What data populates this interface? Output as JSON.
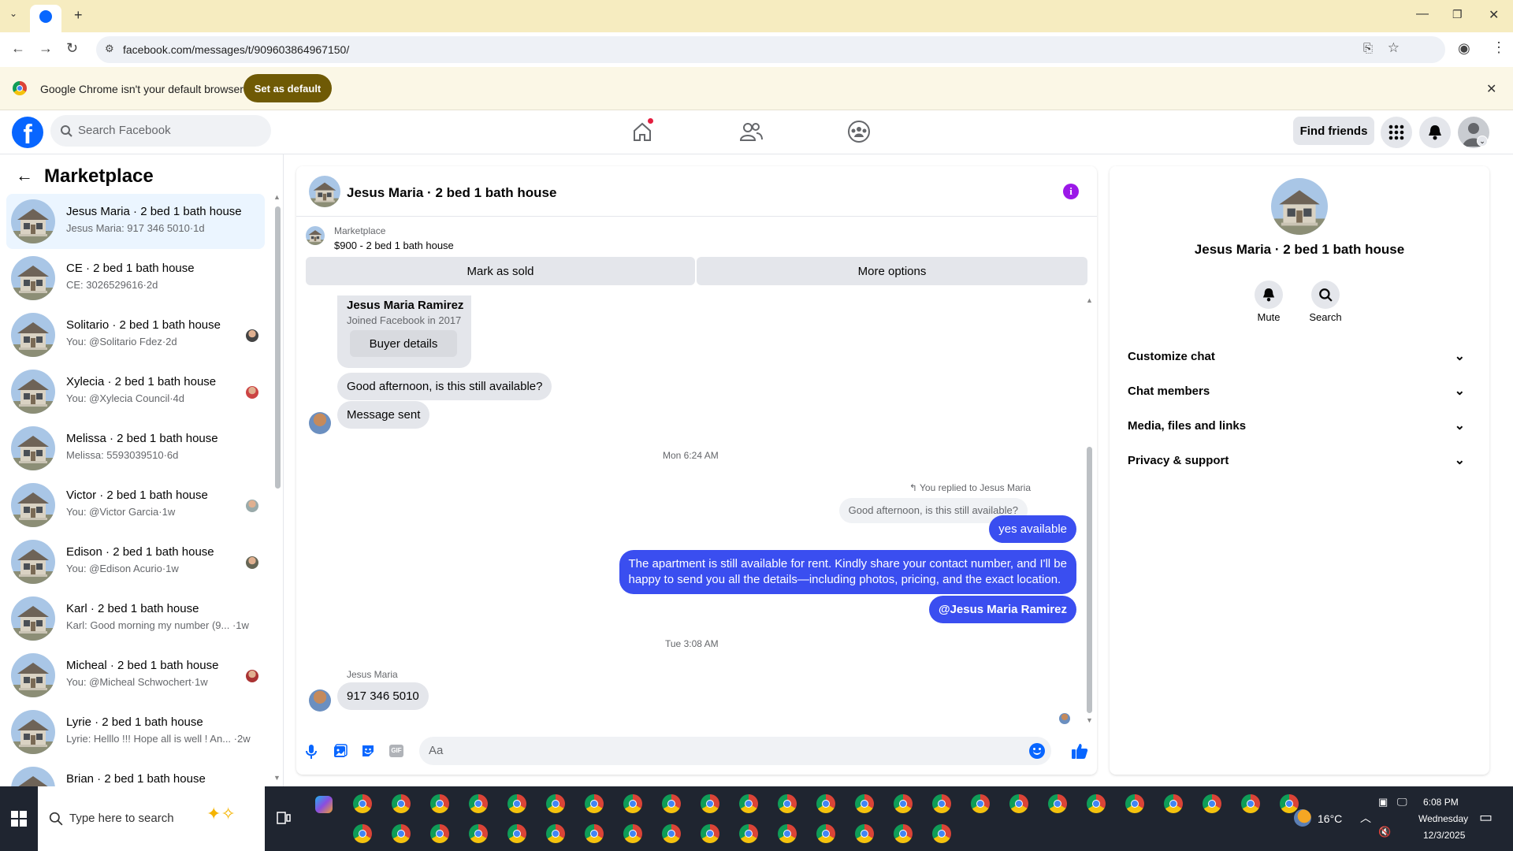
{
  "browser": {
    "url": "facebook.com/messages/t/909603864967150/",
    "infobar_text": "Google Chrome isn't your default browser",
    "set_default_label": "Set as default"
  },
  "fb": {
    "search_placeholder": "Search Facebook",
    "find_friends": "Find friends"
  },
  "left": {
    "title": "Marketplace",
    "conversations": [
      {
        "title": "Jesus Maria · 2 bed 1 bath house",
        "sub": "Jesus Maria: 917 346 5010·1d"
      },
      {
        "title": "CE · 2 bed 1 bath house",
        "sub": "CE: 3026529616·2d"
      },
      {
        "title": "Solitario · 2 bed 1 bath house",
        "sub": "You: @Solitario Fdez·2d"
      },
      {
        "title": "Xylecia · 2 bed 1 bath house",
        "sub": "You: @Xylecia Council·4d"
      },
      {
        "title": "Melissa · 2 bed 1 bath house",
        "sub": "Melissa: 5593039510·6d"
      },
      {
        "title": "Victor · 2 bed 1 bath house",
        "sub": "You: @Victor Garcia·1w"
      },
      {
        "title": "Edison · 2 bed 1 bath house",
        "sub": "You: @Edison Acurio·1w"
      },
      {
        "title": "Karl · 2 bed 1 bath house",
        "sub": "Karl: Good morning my number (9... ·1w"
      },
      {
        "title": "Micheal · 2 bed 1 bath house",
        "sub": "You: @Micheal Schwochert·1w"
      },
      {
        "title": "Lyrie · 2 bed 1 bath house",
        "sub": "Lyrie: Helllo !!! Hope all is well ! An... ·2w"
      },
      {
        "title": "Brian · 2 bed 1 bath house",
        "sub": ""
      }
    ]
  },
  "chat": {
    "title": "Jesus Maria · 2 bed 1 bath house",
    "listing_source": "Marketplace",
    "listing_price": "$900 - 2 bed 1 bath house",
    "mark_sold": "Mark as sold",
    "more_options": "More options",
    "buyer_name": "Jesus Maria Ramirez",
    "buyer_joined": "Joined Facebook in 2017",
    "buyer_details": "Buyer details",
    "msg_incoming_1": "Good afternoon, is this still available?",
    "msg_incoming_2": "Message sent",
    "time_1": "Mon 6:24 AM",
    "replied_to": "You replied to Jesus Maria",
    "quoted": "Good afternoon, is this still available?",
    "msg_out_1": "yes available",
    "msg_out_2_line1": "The apartment is still available for rent. Kindly share your contact number, and I'll be",
    "msg_out_2_line2": "happy to send you all the details—including photos, pricing, and the exact location.",
    "msg_out_3": "@Jesus Maria Ramirez",
    "time_2": "Tue 3:08 AM",
    "sender_name": "Jesus Maria",
    "msg_incoming_3": "917 346 5010",
    "composer_placeholder": "Aa"
  },
  "right": {
    "title": "Jesus Maria · 2 bed 1 bath house",
    "mute": "Mute",
    "search": "Search",
    "sections": [
      "Customize chat",
      "Chat members",
      "Media, files and links",
      "Privacy & support"
    ]
  },
  "taskbar": {
    "search_placeholder": "Type here to search",
    "temperature": "16°C",
    "time": "6:08 PM",
    "day": "Wednesday",
    "date": "12/3/2025"
  },
  "colors": {
    "fb_blue": "#0866ff",
    "bubble_out": "#3a4ef0",
    "info_purple": "#9b18e8"
  }
}
